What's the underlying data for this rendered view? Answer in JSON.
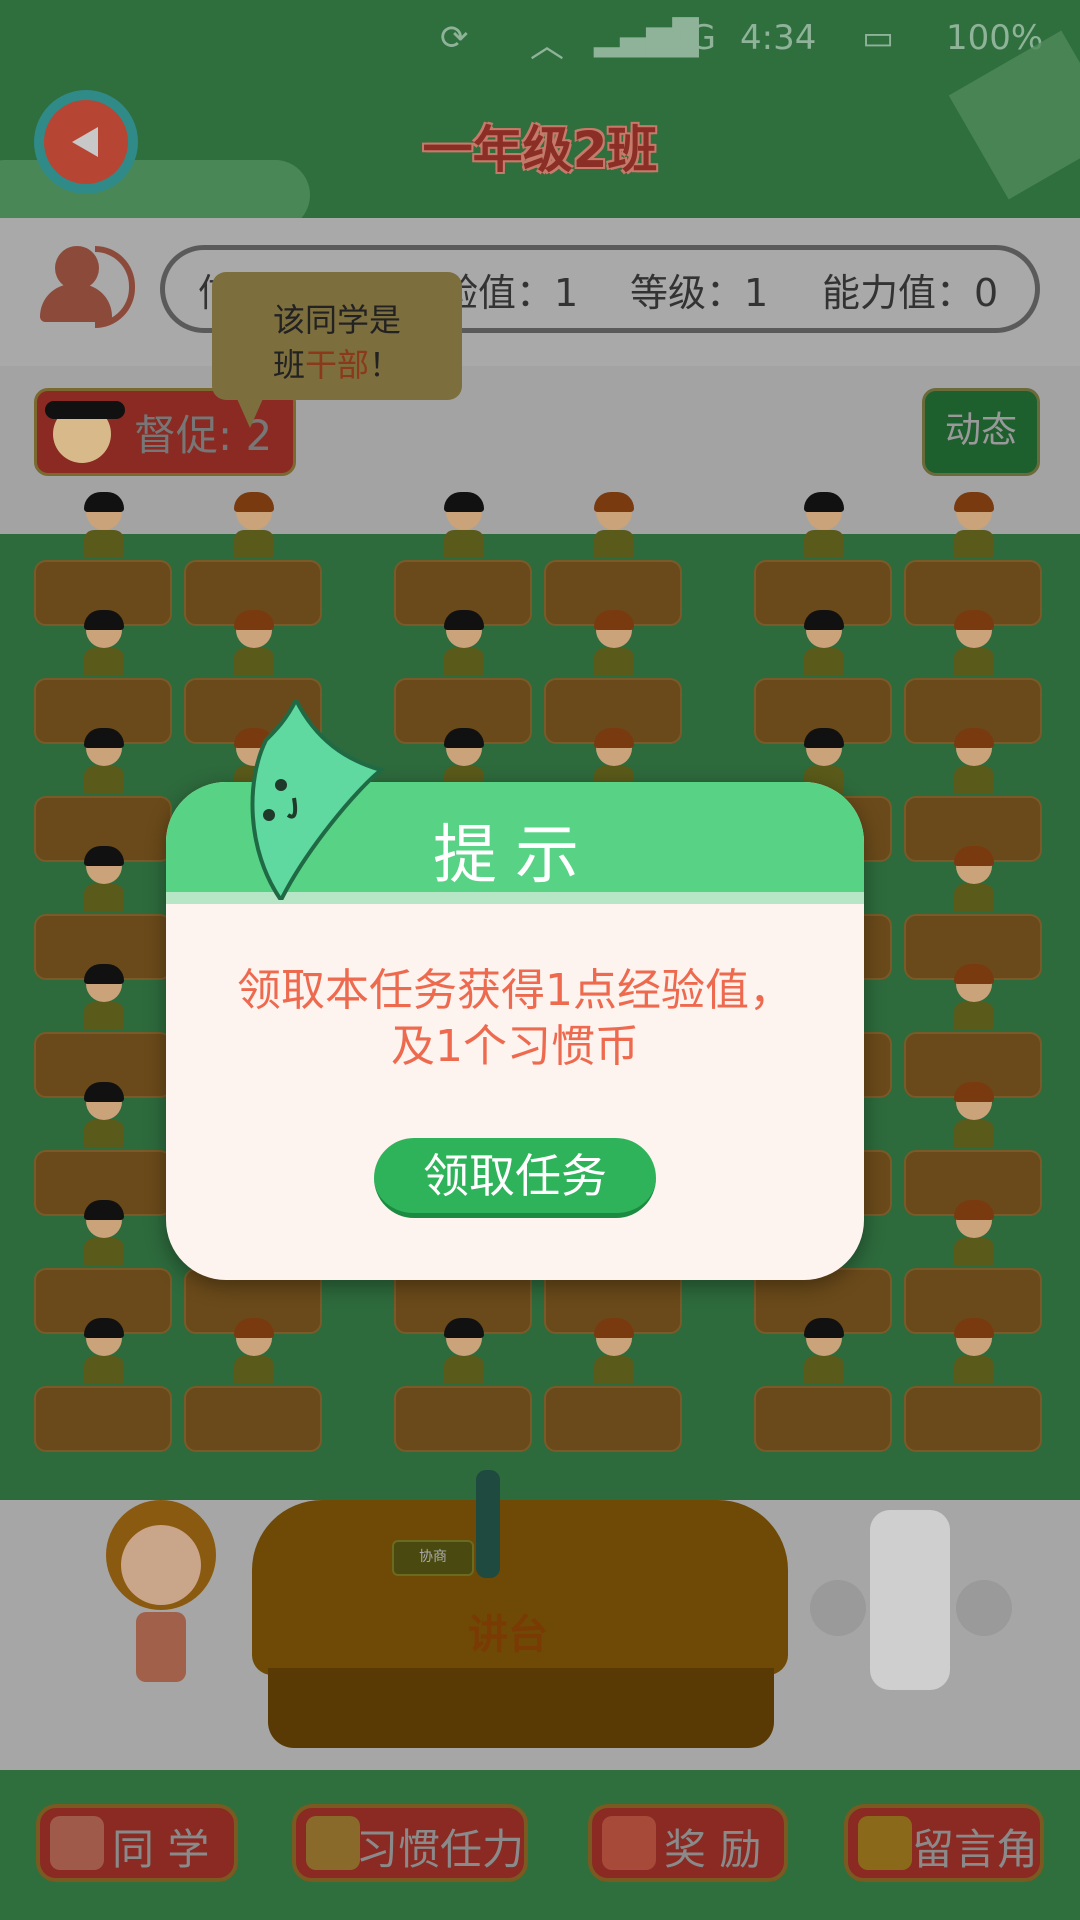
{
  "status_bar": {
    "network": "4G",
    "time": "4:34",
    "battery": "100%"
  },
  "header": {
    "title": "一年级2班"
  },
  "info_bar": {
    "stats_visible": [
      "验值：1",
      "等级：1",
      "能力值：0"
    ],
    "stat_prefix": "信"
  },
  "urge": {
    "label": "督促: 2"
  },
  "tooltip": {
    "line1": "该同学是",
    "line2_prefix": "班",
    "line2_highlight": "干部",
    "line2_suffix": "！"
  },
  "dynamic_button": "动态",
  "podium": {
    "label": "讲台",
    "plaque": "协商"
  },
  "bottom_nav": [
    {
      "label": "同 学",
      "icon": "classmate-icon"
    },
    {
      "label": "习惯任力",
      "icon": "footprint-icon"
    },
    {
      "label": "奖 励",
      "icon": "heart-icon"
    },
    {
      "label": "留言角",
      "icon": "book-icon"
    }
  ],
  "modal": {
    "title": "提示",
    "message_line1": "领取本任务获得1点经验值，",
    "message_line2": "及1个习惯币",
    "button": "领取任务"
  },
  "colors": {
    "accent_green": "#58d385",
    "button_green": "#2fb35a",
    "message_red": "#ee6a4f"
  }
}
